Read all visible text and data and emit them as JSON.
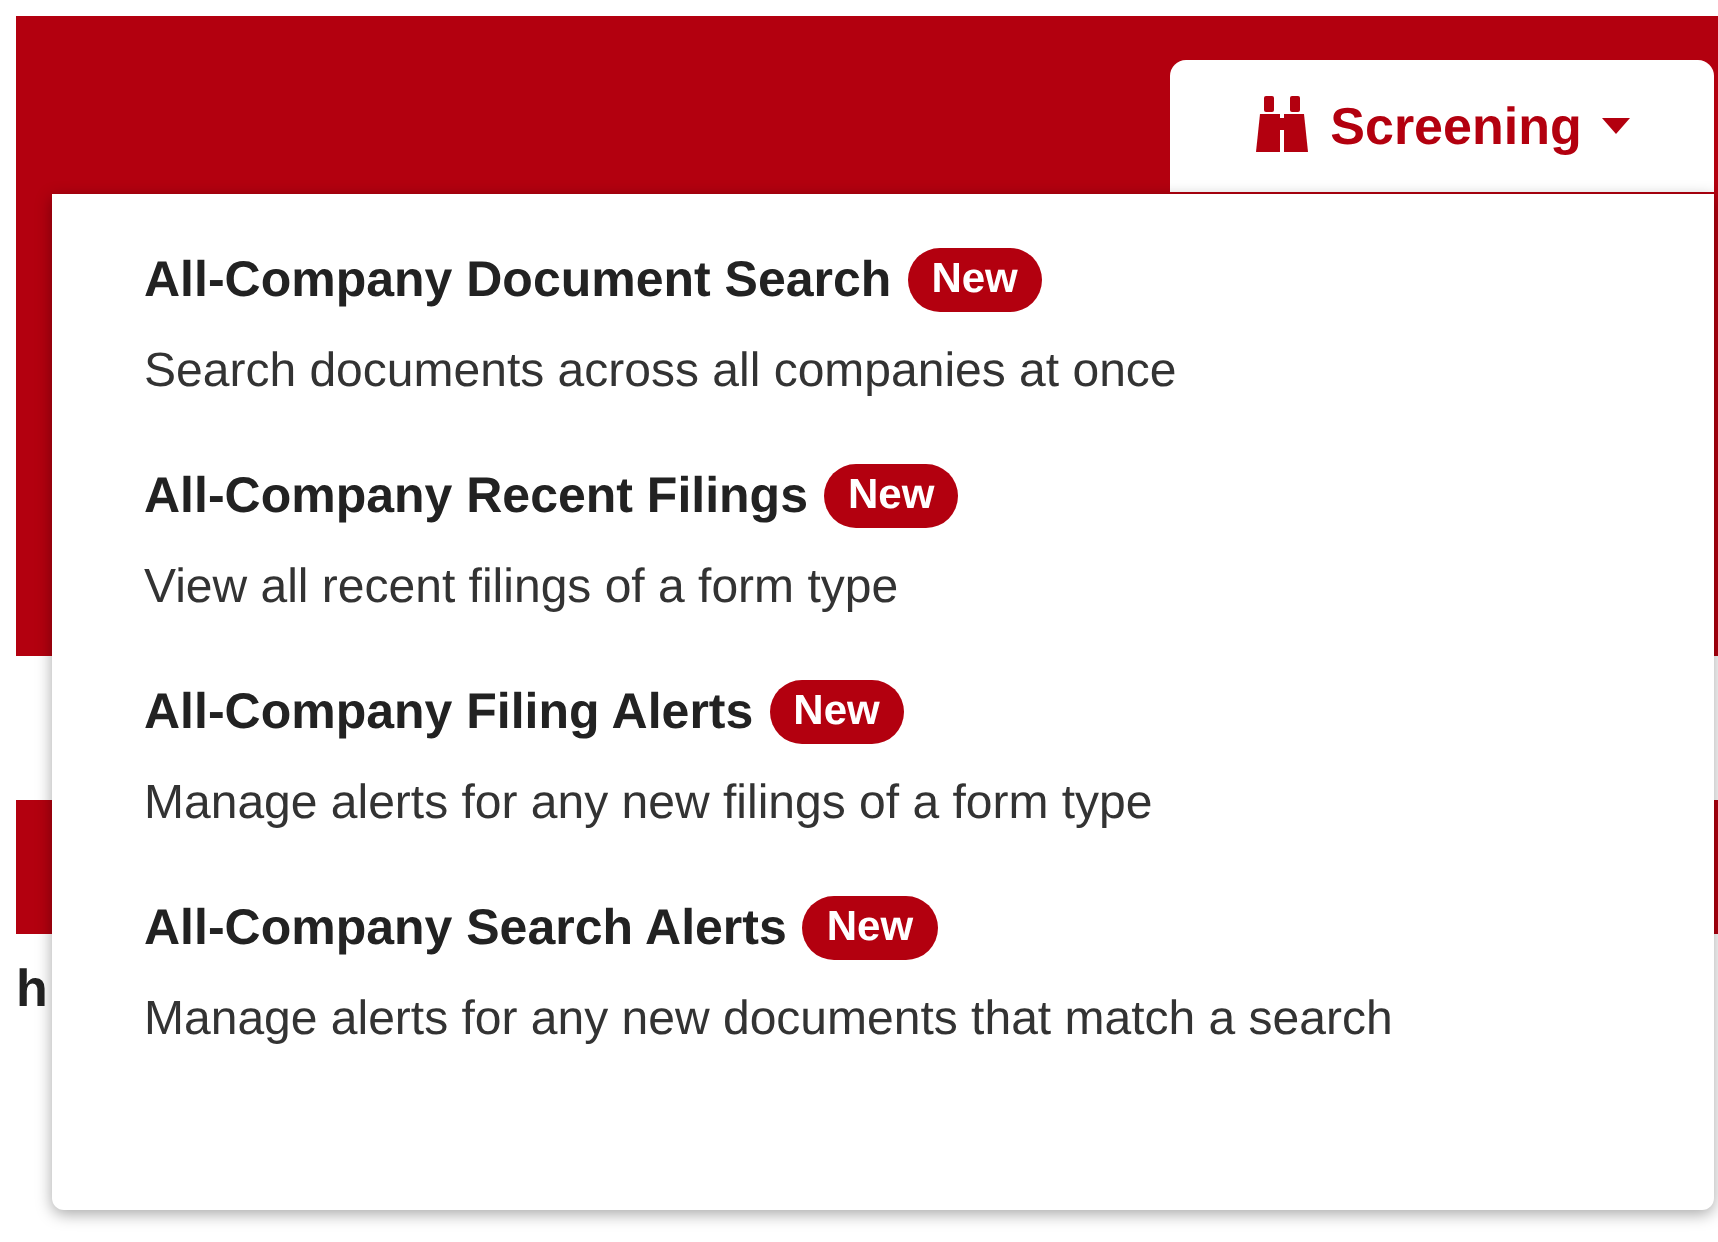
{
  "screening_button": {
    "label": "Screening",
    "expanded": true
  },
  "menu": {
    "items": [
      {
        "title": "All-Company Document Search",
        "badge": "New",
        "description": "Search documents across all companies at once"
      },
      {
        "title": "All-Company Recent Filings",
        "badge": "New",
        "description": "View all recent filings of a form type"
      },
      {
        "title": "All-Company Filing Alerts",
        "badge": "New",
        "description": "Manage alerts for any new filings of a form type"
      },
      {
        "title": "All-Company Search Alerts",
        "badge": "New",
        "description": "Manage alerts for any new documents that match a search"
      }
    ]
  },
  "page_text": "h"
}
